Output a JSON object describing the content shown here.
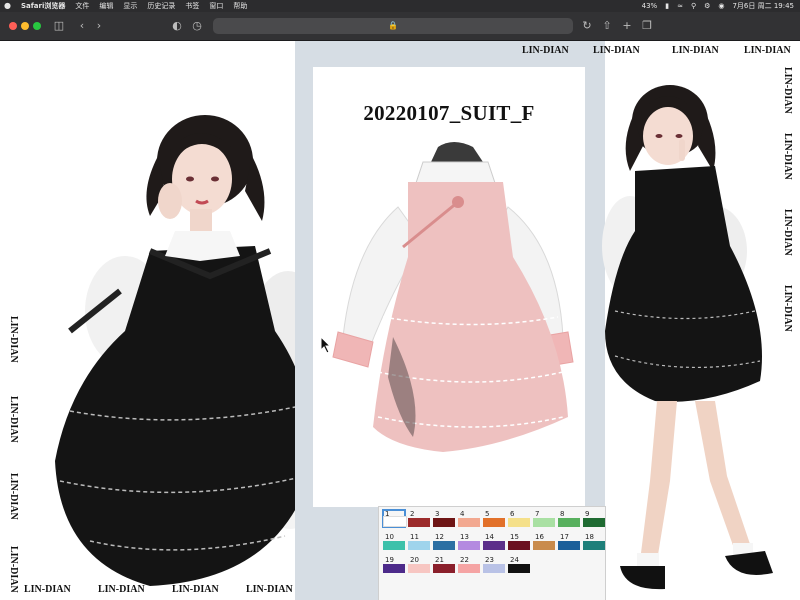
{
  "menubar": {
    "apple": "",
    "app_name": "Safari浏览器",
    "items": [
      "文件",
      "编辑",
      "显示",
      "历史记录",
      "书签",
      "窗口",
      "帮助"
    ],
    "battery": "43%",
    "datetime": "7月6日 周二 19:45"
  },
  "colors": {
    "menubar_bg": "#2c2c2e",
    "toolbar_bg": "#323234",
    "close": "#ff5f57",
    "minimize": "#febc2e",
    "zoom": "#28c840",
    "center_panel_bg": "#d6dde4",
    "selection_outline": "#4a8fd6"
  },
  "toolbar": {
    "icons": [
      "sidebar-icon",
      "back-icon",
      "forward-icon",
      "shield-icon",
      "clock-icon",
      "lock-icon",
      "reload-icon",
      "share-icon",
      "new-tab-icon",
      "tab-overview-icon"
    ]
  },
  "watermark": "LIN-DIAN",
  "product": {
    "title": "20220107_SUIT_F"
  },
  "swatches": [
    {
      "n": "1",
      "color": "#ffffff"
    },
    {
      "n": "2",
      "color": "#9c2b2b"
    },
    {
      "n": "3",
      "color": "#6e1515"
    },
    {
      "n": "4",
      "color": "#f2a890"
    },
    {
      "n": "5",
      "color": "#e2712a"
    },
    {
      "n": "6",
      "color": "#f5e08a"
    },
    {
      "n": "7",
      "color": "#a9e0a3"
    },
    {
      "n": "8",
      "color": "#58b05e"
    },
    {
      "n": "9",
      "color": "#1f6b32"
    },
    {
      "n": "10",
      "color": "#3cc1aa"
    },
    {
      "n": "11",
      "color": "#9fd4ec"
    },
    {
      "n": "12",
      "color": "#2c6fa3"
    },
    {
      "n": "13",
      "color": "#b48ae0"
    },
    {
      "n": "14",
      "color": "#5c2f8a"
    },
    {
      "n": "15",
      "color": "#6b1020"
    },
    {
      "n": "16",
      "color": "#c98b4c"
    },
    {
      "n": "17",
      "color": "#1c5f9a"
    },
    {
      "n": "18",
      "color": "#1e7f7a"
    },
    {
      "n": "19",
      "color": "#4c2a8a"
    },
    {
      "n": "20",
      "color": "#f7c6c2"
    },
    {
      "n": "21",
      "color": "#8a1f2b"
    },
    {
      "n": "22",
      "color": "#f5a4a4"
    },
    {
      "n": "23",
      "color": "#b9c2e6"
    },
    {
      "n": "24",
      "color": "#111111"
    }
  ]
}
